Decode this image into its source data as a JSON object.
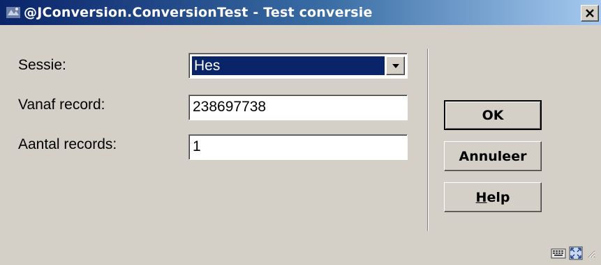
{
  "window": {
    "title": "@JConversion.ConversionTest - Test conversie",
    "close_label": "×"
  },
  "form": {
    "session": {
      "label": "Sessie:",
      "value": "Hes"
    },
    "from_record": {
      "label": "Vanaf record:",
      "value": "238697738"
    },
    "record_count": {
      "label": "Aantal records:",
      "value": "1"
    }
  },
  "buttons": {
    "ok": "OK",
    "cancel": "Annuleer",
    "help_mnemonic": "H",
    "help_rest": "elp"
  },
  "icons": {
    "app": "app-icon",
    "keyboard": "keyboard-icon",
    "resize": "resize-icon",
    "dropdown": "chevron-down-icon"
  }
}
